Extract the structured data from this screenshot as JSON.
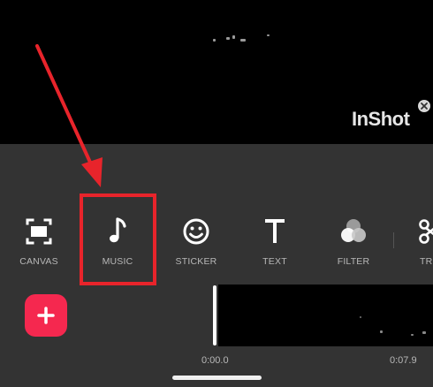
{
  "preview": {
    "watermark": "InShot",
    "watermark_close_icon": "close-icon"
  },
  "toolbar": {
    "items": [
      {
        "label": "CANVAS",
        "icon": "canvas-icon"
      },
      {
        "label": "MUSIC",
        "icon": "music-note-icon"
      },
      {
        "label": "STICKER",
        "icon": "smiley-icon"
      },
      {
        "label": "TEXT",
        "icon": "text-icon"
      },
      {
        "label": "FILTER",
        "icon": "filter-icon"
      },
      {
        "label": "TR",
        "icon": "transition-icon"
      }
    ]
  },
  "timeline": {
    "add_button_icon": "plus-icon",
    "start_time": "0:00.0",
    "end_time": "0:07.9"
  },
  "colors": {
    "panel": "#333333",
    "accent": "#f5284f",
    "annotation": "#e8242b"
  }
}
